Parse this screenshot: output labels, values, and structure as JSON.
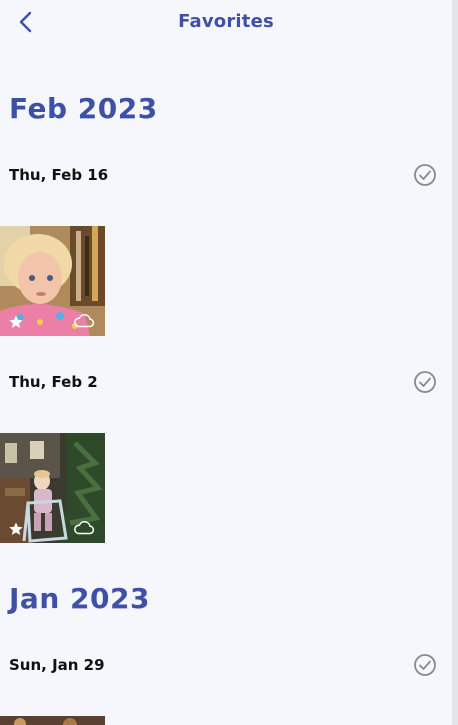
{
  "header": {
    "title": "Favorites",
    "back_icon": "chevron-left-icon"
  },
  "accent_color": "#3f51a6",
  "sections": [
    {
      "month": "Feb 2023",
      "days": [
        {
          "date": "Thu, Feb 16",
          "photos": [
            {
              "favorite": true,
              "cloud": true
            }
          ]
        },
        {
          "date": "Thu, Feb 2",
          "photos": [
            {
              "favorite": true,
              "cloud": true
            }
          ]
        }
      ]
    },
    {
      "month": "Jan 2023",
      "days": [
        {
          "date": "Sun, Jan 29",
          "photos": [
            {
              "favorite": true,
              "cloud": true
            }
          ]
        }
      ]
    }
  ],
  "icons": {
    "select": "check-circle-icon",
    "favorite": "star-icon",
    "cloud": "cloud-icon"
  }
}
